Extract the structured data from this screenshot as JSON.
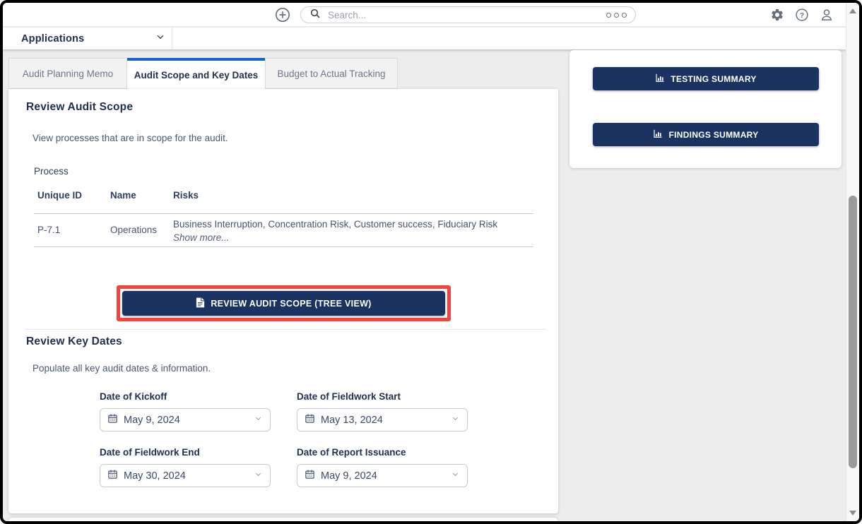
{
  "colors": {
    "navy": "#1a3360",
    "accent_blue": "#1463d1",
    "annotation_red": "#f2433d",
    "page_background": "#ededee"
  },
  "topbar": {
    "search_placeholder": "Search...",
    "icons": [
      "add-icon",
      "search-icon",
      "more-options-icon",
      "settings-icon",
      "help-icon",
      "user-icon"
    ]
  },
  "app_bar": {
    "label": "Applications",
    "icon": "chevron-down-icon"
  },
  "tabs": [
    {
      "label": "Audit Planning Memo"
    },
    {
      "label": "Audit Scope and Key Dates"
    },
    {
      "label": "Budget to Actual Tracking"
    }
  ],
  "active_tab": "Audit Scope and Key Dates",
  "scope_section": {
    "title": "Review Audit Scope",
    "description": "View processes that are in scope for the audit.",
    "table_label": "Process",
    "table": {
      "columns": [
        "Unique ID",
        "Name",
        "Risks"
      ],
      "rows": [
        {
          "unique_id": "P-7.1",
          "name": "Operations",
          "risks": "Business Interruption, Concentration Risk, Customer success, Fiduciary Risk",
          "show_more_label": "Show more..."
        }
      ]
    },
    "tree_view_button_label": "REVIEW AUDIT SCOPE (TREE VIEW)",
    "tree_view_button_icon": "document-icon"
  },
  "key_dates_section": {
    "title": "Review Key Dates",
    "description": "Populate all key audit dates & information.",
    "fields": [
      {
        "label": "Date of Kickoff",
        "value": "May 9, 2024"
      },
      {
        "label": "Date of Fieldwork Start",
        "value": "May 13, 2024"
      },
      {
        "label": "Date of Fieldwork End",
        "value": "May 30, 2024"
      },
      {
        "label": "Date of Report Issuance",
        "value": "May 9, 2024"
      }
    ]
  },
  "side_panel": {
    "buttons": [
      {
        "label": "TESTING SUMMARY",
        "icon": "bar-chart-icon"
      },
      {
        "label": "FINDINGS SUMMARY",
        "icon": "bar-chart-icon"
      }
    ]
  }
}
